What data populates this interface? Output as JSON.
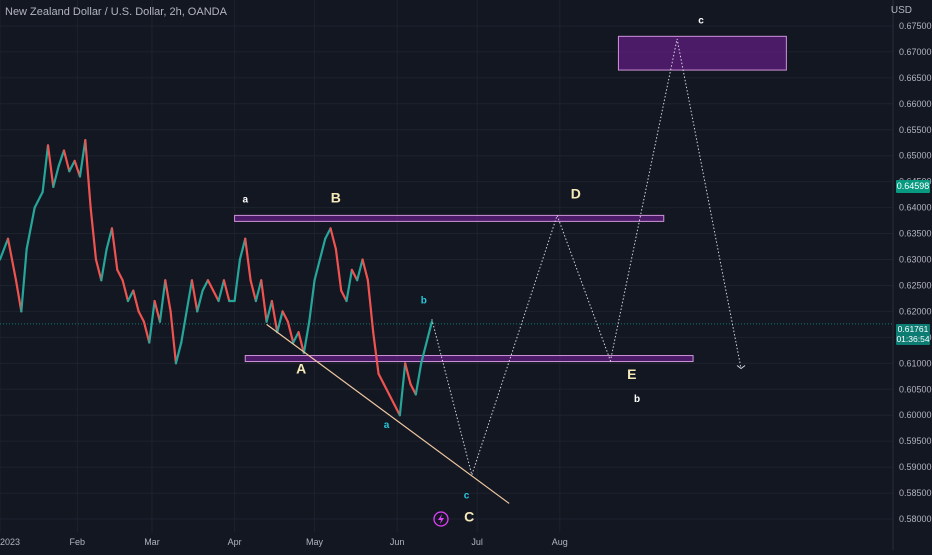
{
  "header": {
    "title": "New Zealand Dollar / U.S. Dollar, 2h, OANDA",
    "currency": "USD"
  },
  "price_tags": {
    "green": "0.64598",
    "current": "0.61761",
    "countdown": "01:36:54"
  },
  "colors": {
    "background": "#131722",
    "grid": "#1e222d",
    "up": "#26a69a",
    "down": "#ef5350",
    "zone_fill": "#7b1fa2",
    "zone_stroke": "#ce93d8",
    "trendline": "#f0c8a0",
    "projection": "#d1d4dc",
    "label_primary": "#f5e9b8",
    "label_minor_teal": "#26c6da",
    "label_minor_white": "#ffffff"
  },
  "chart_data": {
    "type": "line",
    "ylim": [
      0.5775,
      0.68
    ],
    "y_ticks": [
      "0.58000",
      "0.58500",
      "0.59000",
      "0.59500",
      "0.60000",
      "0.60500",
      "0.61000",
      "0.61500",
      "0.62000",
      "0.62500",
      "0.63000",
      "0.63500",
      "0.64000",
      "0.64500",
      "0.65000",
      "0.65500",
      "0.66000",
      "0.66500",
      "0.67000",
      "0.67500"
    ],
    "x_ticks": [
      "2023",
      "Feb",
      "Mar",
      "Apr",
      "May",
      "Jun",
      "Jul",
      "Aug"
    ],
    "x_tick_pos": [
      0,
      29,
      57,
      88,
      118,
      149,
      179,
      210
    ],
    "x_range": [
      0,
      335
    ],
    "price_path": [
      [
        0,
        0.63
      ],
      [
        3,
        0.634
      ],
      [
        6,
        0.626
      ],
      [
        8,
        0.62
      ],
      [
        10,
        0.632
      ],
      [
        13,
        0.64
      ],
      [
        16,
        0.643
      ],
      [
        18,
        0.652
      ],
      [
        20,
        0.644
      ],
      [
        22,
        0.648
      ],
      [
        24,
        0.651
      ],
      [
        26,
        0.647
      ],
      [
        28,
        0.649
      ],
      [
        30,
        0.646
      ],
      [
        32,
        0.653
      ],
      [
        34,
        0.64
      ],
      [
        36,
        0.63
      ],
      [
        38,
        0.626
      ],
      [
        40,
        0.632
      ],
      [
        42,
        0.636
      ],
      [
        44,
        0.628
      ],
      [
        46,
        0.626
      ],
      [
        48,
        0.622
      ],
      [
        50,
        0.624
      ],
      [
        52,
        0.62
      ],
      [
        54,
        0.618
      ],
      [
        56,
        0.614
      ],
      [
        58,
        0.622
      ],
      [
        60,
        0.618
      ],
      [
        62,
        0.626
      ],
      [
        64,
        0.62
      ],
      [
        66,
        0.61
      ],
      [
        68,
        0.614
      ],
      [
        70,
        0.62
      ],
      [
        72,
        0.626
      ],
      [
        74,
        0.62
      ],
      [
        76,
        0.624
      ],
      [
        78,
        0.626
      ],
      [
        80,
        0.624
      ],
      [
        82,
        0.622
      ],
      [
        84,
        0.626
      ],
      [
        86,
        0.622
      ],
      [
        88,
        0.622
      ],
      [
        90,
        0.63
      ],
      [
        92,
        0.634
      ],
      [
        94,
        0.626
      ],
      [
        96,
        0.622
      ],
      [
        98,
        0.626
      ],
      [
        100,
        0.618
      ],
      [
        102,
        0.622
      ],
      [
        104,
        0.616
      ],
      [
        106,
        0.62
      ],
      [
        108,
        0.618
      ],
      [
        110,
        0.614
      ],
      [
        112,
        0.616
      ],
      [
        114,
        0.612
      ],
      [
        116,
        0.618
      ],
      [
        118,
        0.626
      ],
      [
        120,
        0.63
      ],
      [
        122,
        0.634
      ],
      [
        124,
        0.636
      ],
      [
        126,
        0.632
      ],
      [
        128,
        0.624
      ],
      [
        130,
        0.622
      ],
      [
        132,
        0.628
      ],
      [
        134,
        0.626
      ],
      [
        136,
        0.63
      ],
      [
        138,
        0.626
      ],
      [
        140,
        0.616
      ],
      [
        142,
        0.608
      ],
      [
        144,
        0.606
      ],
      [
        146,
        0.604
      ],
      [
        148,
        0.602
      ],
      [
        150,
        0.6
      ],
      [
        152,
        0.61
      ],
      [
        154,
        0.606
      ],
      [
        156,
        0.604
      ],
      [
        158,
        0.61
      ],
      [
        160,
        0.614
      ],
      [
        162,
        0.618
      ]
    ],
    "projection_path": [
      [
        162,
        0.6185
      ],
      [
        177,
        0.5885
      ],
      [
        209,
        0.6385
      ],
      [
        229,
        0.6105
      ],
      [
        254,
        0.6725
      ],
      [
        278,
        0.609
      ]
    ],
    "zones": [
      {
        "x1": 88,
        "x2": 249,
        "y1": 0.6375,
        "y2": 0.6385
      },
      {
        "x1": 92,
        "x2": 260,
        "y1": 0.6105,
        "y2": 0.6115
      },
      {
        "x1": 232,
        "x2": 295,
        "y1": 0.6665,
        "y2": 0.673
      }
    ],
    "trendline": [
      [
        100,
        0.6175
      ],
      [
        191,
        0.583
      ]
    ],
    "current_price": 0.61761,
    "labels": [
      {
        "text": "a",
        "x": 92,
        "y": 0.641,
        "role": "minor_white"
      },
      {
        "text": "B",
        "x": 126,
        "y": 0.641,
        "role": "primary"
      },
      {
        "text": "D",
        "x": 216,
        "y": 0.6418,
        "role": "primary"
      },
      {
        "text": "A",
        "x": 113,
        "y": 0.608,
        "role": "primary"
      },
      {
        "text": "b",
        "x": 159,
        "y": 0.6215,
        "role": "minor_teal"
      },
      {
        "text": "a",
        "x": 145,
        "y": 0.5975,
        "role": "minor_teal"
      },
      {
        "text": "c",
        "x": 175,
        "y": 0.584,
        "role": "minor_teal"
      },
      {
        "text": "C",
        "x": 176,
        "y": 0.5795,
        "role": "primary"
      },
      {
        "text": "E",
        "x": 237,
        "y": 0.607,
        "role": "primary"
      },
      {
        "text": "b",
        "x": 239,
        "y": 0.6025,
        "role": "minor_white"
      },
      {
        "text": "c",
        "x": 263,
        "y": 0.6755,
        "role": "minor_white"
      }
    ]
  }
}
